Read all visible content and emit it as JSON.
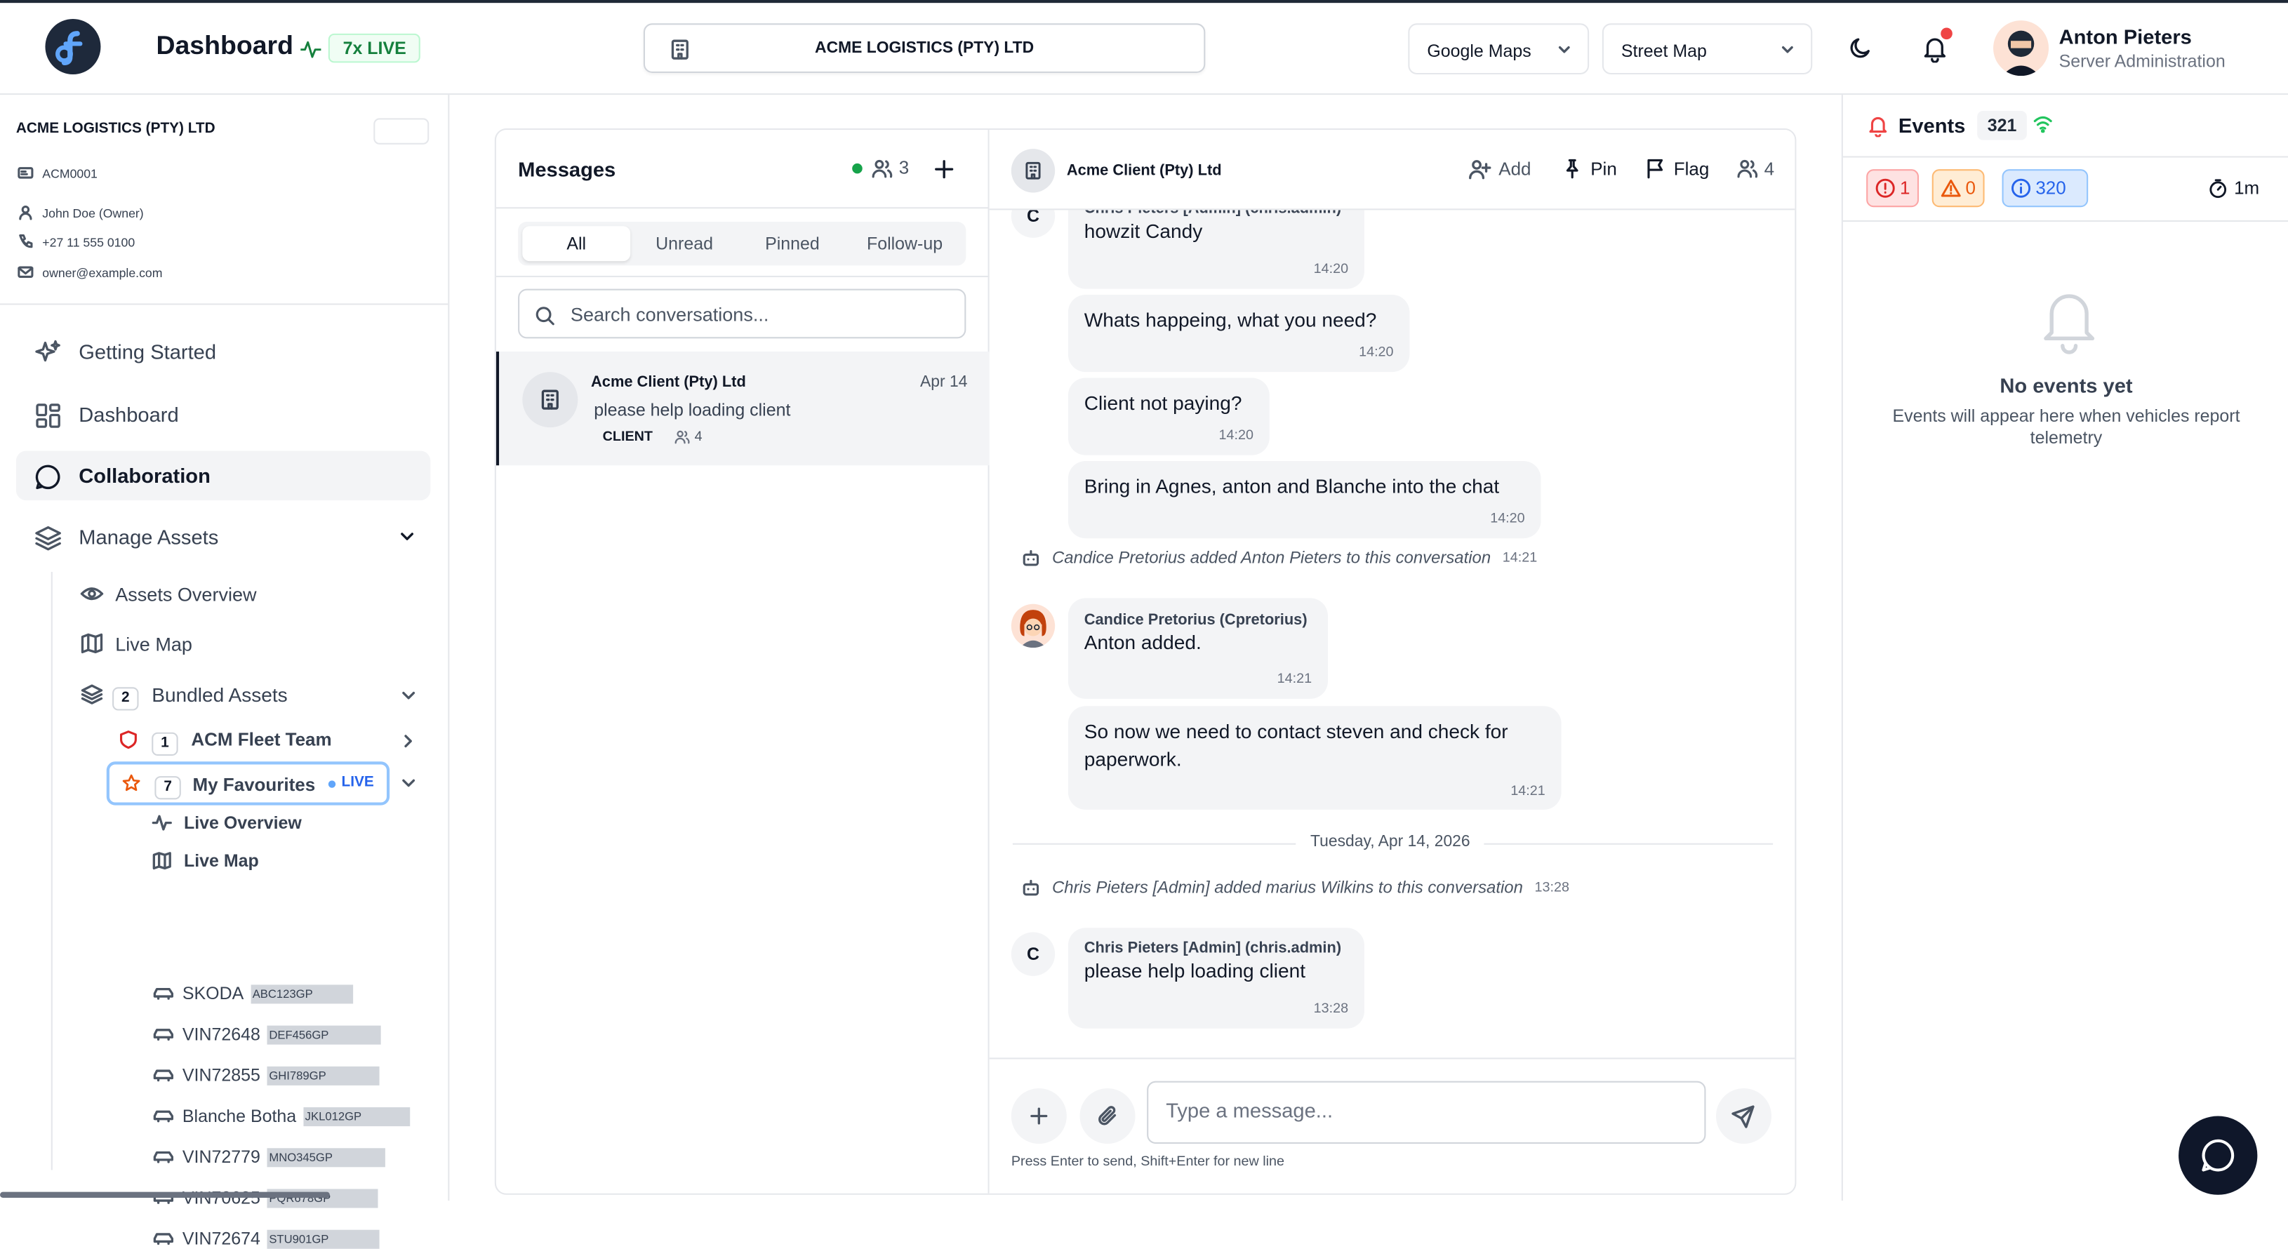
{
  "header": {
    "title": "Dashboard",
    "live_badge": "7x LIVE",
    "company": "ACME LOGISTICS (PTY) LTD",
    "map_provider": "Google Maps",
    "map_style": "Street Map",
    "user_name": "Anton Pieters",
    "user_role": "Server Administration"
  },
  "sidebar": {
    "company_name": "ACME LOGISTICS (PTY) LTD",
    "account_code": "ACM0001",
    "owner": "John Doe (Owner)",
    "phone": "+27 11 555 0100",
    "email": "owner@example.com",
    "nav": {
      "getting_started": "Getting Started",
      "dashboard": "Dashboard",
      "collaboration": "Collaboration",
      "manage_assets": "Manage Assets"
    },
    "assets_overview": "Assets Overview",
    "live_map": "Live Map",
    "bundled_assets": {
      "label": "Bundled Assets",
      "count": "2"
    },
    "fleet_team": {
      "label": "ACM Fleet Team",
      "count": "1"
    },
    "favourites": {
      "label": "My Favourites",
      "count": "7",
      "live": "LIVE"
    },
    "fav_live_overview": "Live Overview",
    "fav_live_map": "Live Map",
    "vehicles": [
      {
        "name": "SKODA",
        "plate": "ABC123GP"
      },
      {
        "name": "VIN72648",
        "plate": "DEF456GP"
      },
      {
        "name": "VIN72855",
        "plate": "GHI789GP"
      },
      {
        "name": "Blanche Botha",
        "plate": "JKL012GP"
      },
      {
        "name": "VIN72779",
        "plate": "MNO345GP"
      },
      {
        "name": "VIN70625",
        "plate": "PQR678GP"
      },
      {
        "name": "VIN72674",
        "plate": "STU901GP"
      }
    ]
  },
  "messages": {
    "title": "Messages",
    "online_count": "3",
    "tabs": [
      "All",
      "Unread",
      "Pinned",
      "Follow-up"
    ],
    "search_placeholder": "Search conversations...",
    "conversation": {
      "name": "Acme Client (Pty) Ltd",
      "date": "Apr 14",
      "preview": "please help loading client",
      "tag": "CLIENT",
      "members": "4"
    }
  },
  "chat": {
    "title": "Acme Client (Pty) Ltd",
    "add": "Add",
    "pin": "Pin",
    "flag": "Flag",
    "members": "4",
    "msg1": {
      "sender": "Chris Pieters [Admin] (chris.admin)",
      "text": "howzit Candy",
      "time": "14:20",
      "initial": "C"
    },
    "msg2": {
      "text": "Whats happeing, what you need?",
      "time": "14:20"
    },
    "msg3": {
      "text": "Client not paying?",
      "time": "14:20"
    },
    "msg4": {
      "text": "Bring in Agnes, anton and Blanche into the chat",
      "time": "14:20"
    },
    "sys1": {
      "text": "Candice Pretorius added Anton Pieters to this conversation",
      "time": "14:21"
    },
    "msg5": {
      "sender": "Candice Pretorius (Cpretorius)",
      "text": "Anton added.",
      "time": "14:21"
    },
    "msg6": {
      "text": "So now we need to contact steven and check for paperwork.",
      "time": "14:21"
    },
    "date_divider": "Tuesday, Apr 14, 2026",
    "sys2": {
      "text": "Chris Pieters [Admin] added marius Wilkins to this conversation",
      "time": "13:28"
    },
    "msg7": {
      "sender": "Chris Pieters [Admin] (chris.admin)",
      "text": "please help loading client",
      "time": "13:28",
      "initial": "C"
    },
    "input_placeholder": "Type a message...",
    "hint": "Press Enter to send, Shift+Enter for new line"
  },
  "events": {
    "title": "Events",
    "count": "321",
    "critical": "1",
    "warning": "0",
    "info": "320",
    "interval": "1m",
    "empty_title": "No events yet",
    "empty_text": "Events will appear here when vehicles report telemetry"
  },
  "colors": {
    "accent": "#2563eb",
    "live_green": "#15803d",
    "danger": "#dc2626",
    "warning": "#ea580c",
    "info": "#2563eb",
    "dark": "#0f172a"
  }
}
